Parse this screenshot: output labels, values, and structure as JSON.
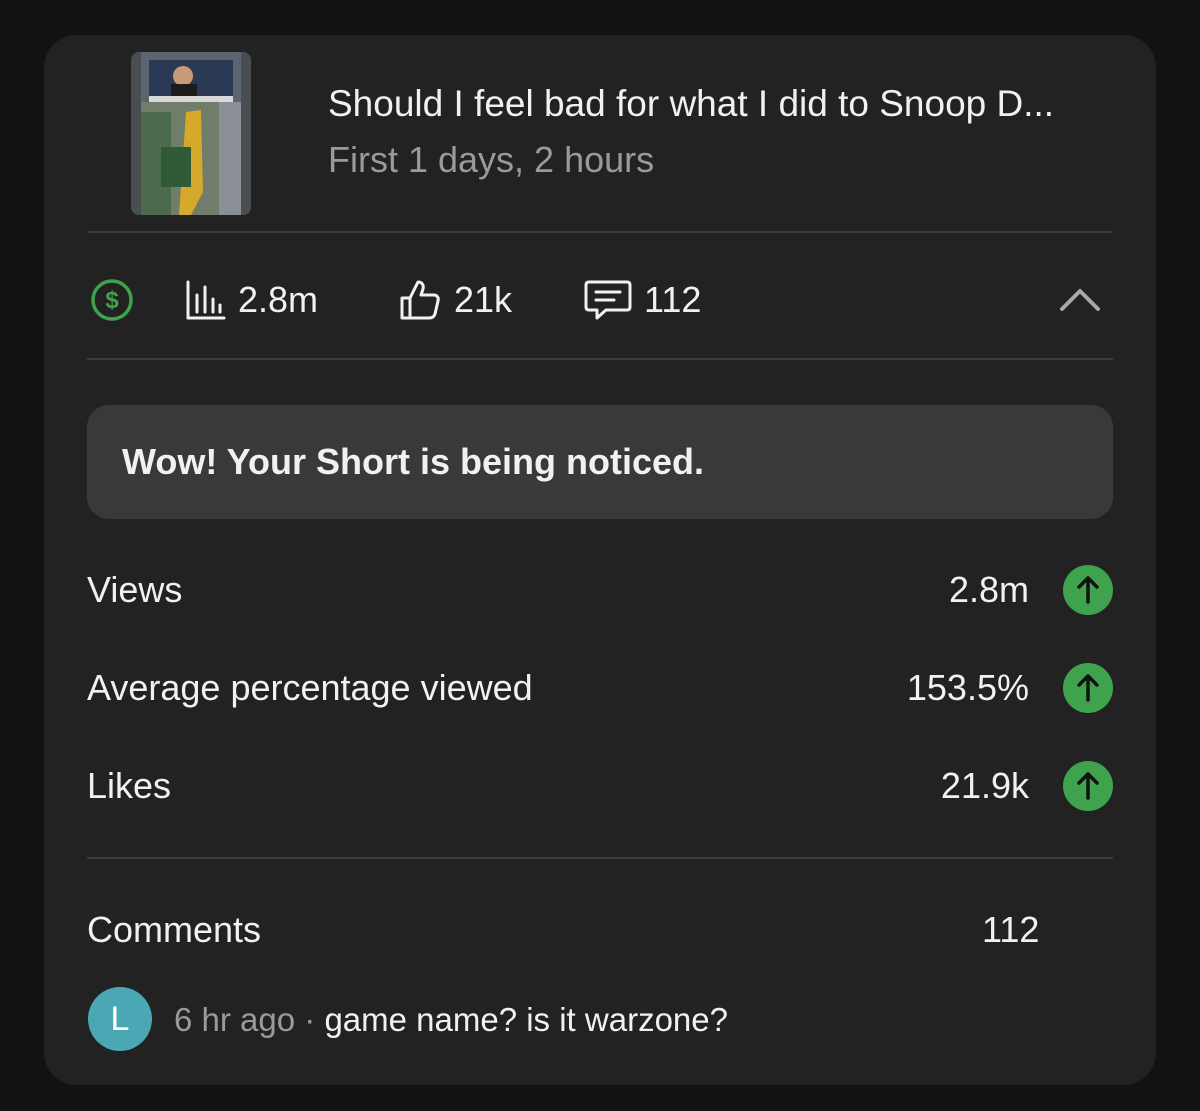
{
  "video": {
    "title": "Should I feel bad for what I did to Snoop D...",
    "period": "First 1 days, 2 hours",
    "thumbnail_icon": "video-thumbnail"
  },
  "stats": {
    "monetization_icon": "dollar-circle-icon",
    "views": "2.8m",
    "likes": "21k",
    "comments": "112",
    "colors": {
      "monetization": "#3fa34d"
    }
  },
  "notice": {
    "text": "Wow! Your Short is being noticed."
  },
  "metrics": [
    {
      "label": "Views",
      "value": "2.8m",
      "trend": "up"
    },
    {
      "label": "Average percentage viewed",
      "value": "153.5%",
      "trend": "up"
    },
    {
      "label": "Likes",
      "value": "21.9k",
      "trend": "up"
    }
  ],
  "comments_section": {
    "label": "Comments",
    "count": "112",
    "latest": {
      "avatar_initial": "L",
      "time": "6 hr ago",
      "separator": "·",
      "text": "game name? is it warzone?",
      "avatar_color": "#4aa8b5"
    }
  },
  "colors": {
    "card_bg": "#222222",
    "notice_bg": "#393939",
    "trend_up": "#3fa34d"
  }
}
